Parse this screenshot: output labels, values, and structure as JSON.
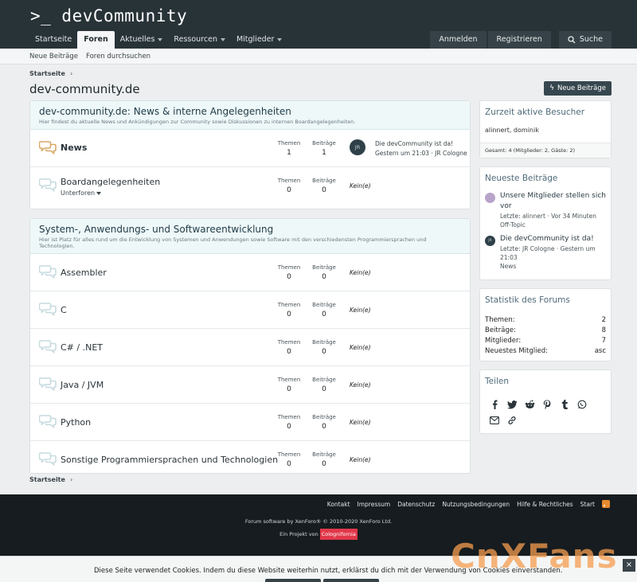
{
  "site": {
    "logo": ">_ devCommunity"
  },
  "nav": {
    "items": [
      {
        "label": "Startseite"
      },
      {
        "label": "Foren"
      },
      {
        "label": "Aktuelles"
      },
      {
        "label": "Ressourcen"
      },
      {
        "label": "Mitglieder"
      }
    ],
    "login": "Anmelden",
    "register": "Registrieren",
    "search": "Suche"
  },
  "subnav": {
    "new_posts": "Neue Beiträge",
    "search_forums": "Foren durchsuchen"
  },
  "breadcrumb": {
    "home": "Startseite"
  },
  "page": {
    "title": "dev-community.de",
    "new_post_button": "Neue Beiträge"
  },
  "labels": {
    "threads": "Themen",
    "posts": "Beiträge",
    "none": "Kein(e)",
    "subforums": "Unterforen"
  },
  "categories": [
    {
      "title": "dev-community.de: News & interne Angelegenheiten",
      "description": "Hier findest du aktuelle News und Ankündigungen zur Community sowie Diskussionen zu internen Boardangelegenheiten.",
      "nodes": [
        {
          "title": "News",
          "threads": "1",
          "posts": "1",
          "last_avatar": "JR",
          "last_title": "Die devCommunity ist da!",
          "last_meta": "Gestern um 21:03 · JR Cologne"
        },
        {
          "title": "Boardangelegenheiten",
          "threads": "0",
          "posts": "0"
        }
      ]
    },
    {
      "title": "System-, Anwendungs- und Softwareentwicklung",
      "description": "Hier ist Platz für alles rund um die Entwicklung von Systemen und Anwendungen sowie Software mit den verschiedensten Programmiersprachen und Technologien.",
      "nodes": [
        {
          "title": "Assembler",
          "threads": "0",
          "posts": "0"
        },
        {
          "title": "C",
          "threads": "0",
          "posts": "0"
        },
        {
          "title": "C# / .NET",
          "threads": "0",
          "posts": "0"
        },
        {
          "title": "Java / JVM",
          "threads": "0",
          "posts": "0"
        },
        {
          "title": "Python",
          "threads": "0",
          "posts": "0"
        },
        {
          "title": "Sonstige Programmiersprachen und Technologien",
          "threads": "0",
          "posts": "0"
        }
      ]
    }
  ],
  "sidebar": {
    "visitors": {
      "title": "Zurzeit aktive Besucher",
      "names": "alinnert, dominik",
      "total": "Gesamt: 4 (Mitglieder: 2, Gäste: 2)"
    },
    "latest": {
      "title": "Neueste Beiträge",
      "posts": [
        {
          "title_1": "Unsere Mitglieder stellen sich",
          "title_2": "vor",
          "meta_1": "Letzte: alinnert · Vor 34 Minuten",
          "meta_2": "Off-Topic"
        },
        {
          "avatar": "JR",
          "title_1": "Die devCommunity ist da!",
          "meta_1": "Letzte: JR Cologne · Gestern um",
          "meta_2": "21:03",
          "meta_3": "News"
        }
      ]
    },
    "stats": {
      "title": "Statistik des Forums",
      "rows": [
        {
          "k": "Themen:",
          "v": "2"
        },
        {
          "k": "Beiträge:",
          "v": "8"
        },
        {
          "k": "Mitglieder:",
          "v": "7"
        },
        {
          "k": "Neuestes Mitglied:",
          "v": "asc"
        }
      ]
    },
    "share": {
      "title": "Teilen"
    }
  },
  "footer": {
    "links": [
      "Kontakt",
      "Impressum",
      "Datenschutz",
      "Nutzungsbedingungen",
      "Hilfe & Rechtliches",
      "Start"
    ],
    "copyright": "Forum software by XenForo® © 2010-2020 XenForo Ltd.",
    "project_prefix": "Ein Projekt von",
    "project_name": "Colognifornia"
  },
  "cookie": {
    "text": "Diese Seite verwendet Cookies. Indem du diese Website weiterhin nutzt, erklärst du dich mit der Verwendung von Cookies einverstanden."
  },
  "watermark": "CnXFans"
}
